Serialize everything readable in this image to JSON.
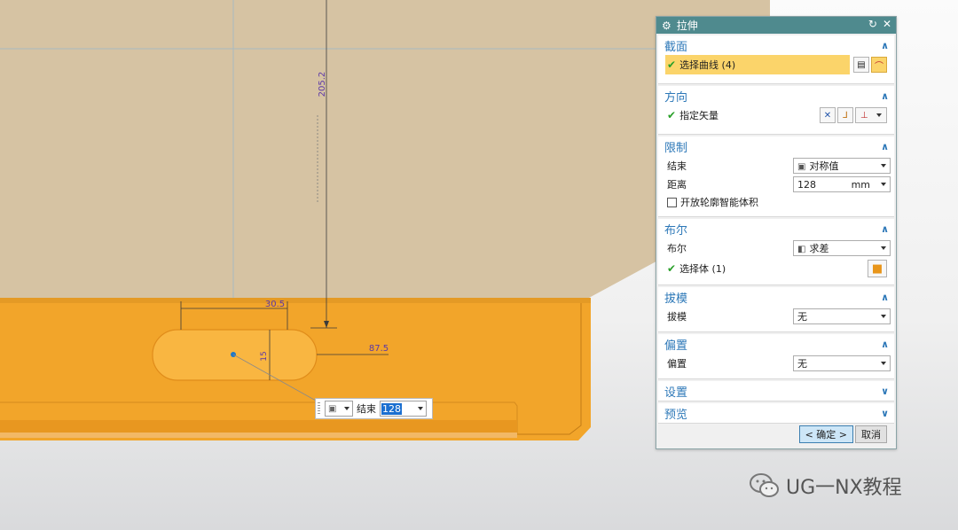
{
  "viewport": {
    "dim_vertical": "205.2",
    "dim_width": "30.5",
    "dim_offset": "87.5",
    "dim_height": "15",
    "colors": {
      "orange": "#f4a623",
      "tan": "#d7c1a0",
      "slot": "#f9b641"
    }
  },
  "mini_toolbar": {
    "type_icon": "cube-icon",
    "label": "结束",
    "value": "128"
  },
  "dialog": {
    "title": "拉伸",
    "sections": {
      "section": {
        "title": "截面",
        "select_curve": "选择曲线 (4)"
      },
      "direction": {
        "title": "方向",
        "specify_vector": "指定矢量"
      },
      "limits": {
        "title": "限制",
        "end_label": "结束",
        "end_value": "对称值",
        "distance_label": "距离",
        "distance_value": "128",
        "distance_unit": "mm",
        "open_profile_label": "开放轮廓智能体积"
      },
      "boolean": {
        "title": "布尔",
        "boolean_label": "布尔",
        "boolean_value": "求差",
        "select_body": "选择体 (1)"
      },
      "draft": {
        "title": "拔模",
        "draft_label": "拔模",
        "draft_value": "无"
      },
      "offset": {
        "title": "偏置",
        "offset_label": "偏置",
        "offset_value": "无"
      },
      "settings": {
        "title": "设置"
      },
      "preview": {
        "title": "预览"
      }
    },
    "ok_label": "< 确定 >",
    "cancel_label": "取消"
  },
  "watermark": {
    "text": "UG一NX教程"
  }
}
